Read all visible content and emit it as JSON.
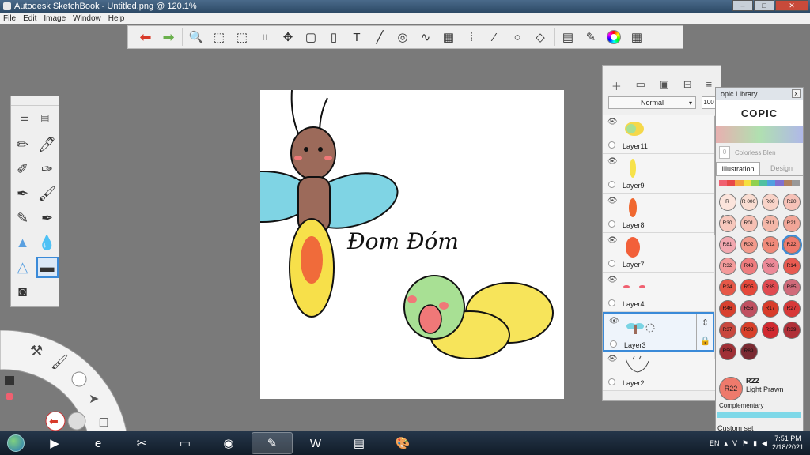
{
  "window": {
    "title": "Autodesk SketchBook - Untitled.png @ 120.1%",
    "min_label": "–",
    "max_label": "□",
    "close_label": "✕"
  },
  "menu": [
    "File",
    "Edit",
    "Image",
    "Window",
    "Help"
  ],
  "toolbar_icons": [
    "undo-icon",
    "redo-icon",
    "zoom-icon",
    "select-icon",
    "crop-select-icon",
    "crop-icon",
    "lasso-icon",
    "transform-icon",
    "fill-icon",
    "text-icon",
    "ruler-icon",
    "ellipse-guide-icon",
    "french-curve-icon",
    "perspective-icon",
    "symmetry-icon",
    "line-icon",
    "circle-icon",
    "shapes-icon",
    "copic-library-icon",
    "brush-library-icon",
    "color-wheel-icon",
    "palette-icon"
  ],
  "canvas": {
    "text": "Đom Đóm"
  },
  "layers_panel": {
    "blend_mode": "Normal",
    "opacity": "100",
    "layers": [
      {
        "name": "Layer11",
        "eye": "👁",
        "thumb_color": "#f5d84a"
      },
      {
        "name": "Layer9",
        "eye": "👁",
        "thumb_color": "#f7e24a"
      },
      {
        "name": "Layer8",
        "eye": "👁",
        "thumb_color": "#f06830"
      },
      {
        "name": "Layer7",
        "eye": "👁",
        "thumb_color": "#f2603a"
      },
      {
        "name": "Layer4",
        "eye": "👁",
        "thumb_color": "#f06070"
      },
      {
        "name": "Layer3",
        "eye": "👁",
        "thumb_color": "#7ad4e4"
      },
      {
        "name": "Layer2",
        "eye": "👁",
        "thumb_color": "#444444"
      }
    ]
  },
  "copic": {
    "title": "opic Library",
    "brand": "COPIC",
    "blender_value": "0",
    "blender_label": "Colorless Blen",
    "tabs": [
      "Illustration",
      "Design"
    ],
    "chips": [
      {
        "label": "R 0000",
        "color": "#fbe4dc"
      },
      {
        "label": "R 000",
        "color": "#f9ddd2"
      },
      {
        "label": "R00",
        "color": "#f8d3c8"
      },
      {
        "label": "R20",
        "color": "#f6c2b8"
      },
      {
        "label": "R30",
        "color": "#f7c8bd"
      },
      {
        "label": "R01",
        "color": "#f6c0b4"
      },
      {
        "label": "R11",
        "color": "#f4b7a8"
      },
      {
        "label": "R21",
        "color": "#f1a698"
      },
      {
        "label": "R81",
        "color": "#f2a8b0"
      },
      {
        "label": "R02",
        "color": "#f29a8c"
      },
      {
        "label": "R12",
        "color": "#f08a7a"
      },
      {
        "label": "R22",
        "color": "#ee7a6c"
      },
      {
        "label": "R32",
        "color": "#f39b9b"
      },
      {
        "label": "R43",
        "color": "#ee7c7e"
      },
      {
        "label": "R83",
        "color": "#ec8a98"
      },
      {
        "label": "R14",
        "color": "#e85a50"
      },
      {
        "label": "R24",
        "color": "#e65848"
      },
      {
        "label": "R05",
        "color": "#e5483a"
      },
      {
        "label": "R35",
        "color": "#e04a50"
      },
      {
        "label": "R85",
        "color": "#d06a7a"
      },
      {
        "label": "R46",
        "color": "#d8402e"
      },
      {
        "label": "R56",
        "color": "#c05060"
      },
      {
        "label": "R17",
        "color": "#d83c2a"
      },
      {
        "label": "R27",
        "color": "#d83838"
      },
      {
        "label": "R37",
        "color": "#c8483e"
      },
      {
        "label": "R08",
        "color": "#d8402a"
      },
      {
        "label": "R29",
        "color": "#d02a30"
      },
      {
        "label": "R39",
        "color": "#b03038"
      },
      {
        "label": "R59",
        "color": "#a03036"
      },
      {
        "label": "R89",
        "color": "#7a2a32"
      }
    ],
    "current_code": "R22",
    "current_name": "Light Prawn",
    "complementary_label": "Complementary",
    "custom_set_label": "Custom set"
  },
  "taskbar": {
    "apps": [
      "media-player-icon",
      "internet-explorer-icon",
      "snipping-tool-icon",
      "file-explorer-icon",
      "chrome-icon",
      "sketchbook-icon",
      "word-icon",
      "winrar-icon",
      "paint-icon"
    ],
    "lang": "EN",
    "time": "7:51 PM",
    "date": "2/18/2021"
  }
}
